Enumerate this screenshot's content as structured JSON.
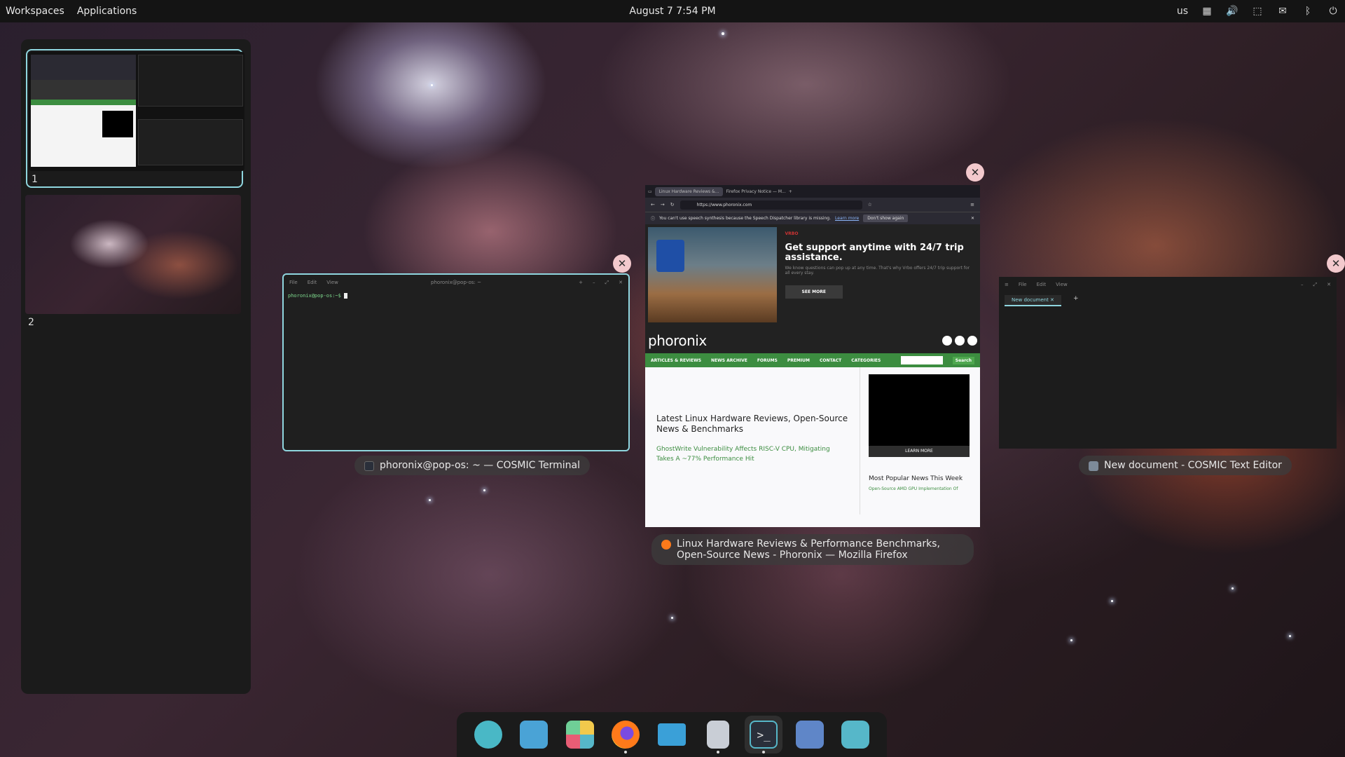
{
  "top_panel": {
    "workspaces_label": "Workspaces",
    "applications_label": "Applications",
    "clock": "August 7 7:54 PM",
    "keyboard_layout": "us"
  },
  "workspaces": [
    {
      "number": "1"
    },
    {
      "number": "2"
    }
  ],
  "terminal": {
    "menu": [
      "File",
      "Edit",
      "View"
    ],
    "title": "phoronix@pop-os: ~",
    "prompt": "phoronix@pop-os:~$",
    "label": "phoronix@pop-os: ~ — COSMIC Terminal"
  },
  "firefox": {
    "tabs": [
      "Linux Hardware Reviews &...",
      "Firefox Privacy Notice — M..."
    ],
    "url": "https://www.phoronix.com",
    "notice": "You can't use speech synthesis because the Speech Dispatcher library is missing.",
    "notice_link": "Learn more",
    "notice_button": "Don't show again",
    "ad_sponsor": "VRBO",
    "ad_headline": "Get support anytime with 24/7 trip assistance.",
    "ad_small": "We know questions can pop up at any time. That's why Vrbo offers 24/7 trip support for all every stay.",
    "ad_button": "SEE MORE",
    "site_logo": "phoronix",
    "nav": [
      "ARTICLES & REVIEWS",
      "NEWS ARCHIVE",
      "FORUMS",
      "PREMIUM",
      "CONTACT",
      "CATEGORIES"
    ],
    "search_button": "Search",
    "headline": "Latest Linux Hardware Reviews, Open-Source News & Benchmarks",
    "article": "GhostWrite Vulnerability Affects RISC-V CPU, Mitigating Takes A ~77% Performance Hit",
    "video_button": "LEARN MORE",
    "popular": "Most Popular News This Week",
    "popular_item": "Open-Source AMD GPU Implementation Of",
    "label": "Linux Hardware Reviews & Performance Benchmarks, Open-Source News - Phoronix — Mozilla Firefox"
  },
  "editor": {
    "menu": [
      "File",
      "Edit",
      "View"
    ],
    "tab": "New document",
    "label": "New document - COSMIC Text Editor"
  },
  "dock": [
    {
      "name": "Launcher",
      "icon": "launcher-icon",
      "color": "#49b8c6"
    },
    {
      "name": "Workspaces",
      "icon": "workspaces-icon",
      "color": "#4aa3d6"
    },
    {
      "name": "Applications",
      "icon": "app-grid-icon",
      "color": "#f2c94c"
    },
    {
      "name": "Firefox",
      "icon": "firefox-icon",
      "color": "#ff7a1a"
    },
    {
      "name": "Files",
      "icon": "folder-icon",
      "color": "#3aa0d8"
    },
    {
      "name": "Text Editor",
      "icon": "text-editor-icon",
      "color": "#7d8a99"
    },
    {
      "name": "Terminal",
      "icon": "terminal-icon",
      "color": "#2a2f3a"
    },
    {
      "name": "Pop Shop",
      "icon": "shop-icon",
      "color": "#5f86c8"
    },
    {
      "name": "Settings",
      "icon": "settings-toggle-icon",
      "color": "#56b7c9"
    }
  ]
}
